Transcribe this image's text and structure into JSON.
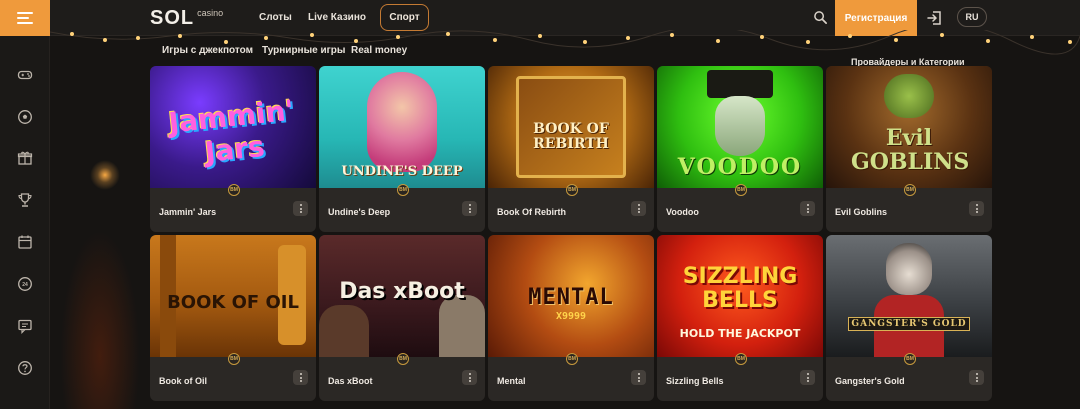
{
  "header": {
    "logo_main": "SOL",
    "logo_sub": "casino",
    "nav": {
      "slots": "Слоты",
      "live_casino": "Live Казино",
      "sport": "Спорт"
    },
    "register_label": "Регистрация",
    "lang_label": "RU",
    "accent_color": "#ef9a3c"
  },
  "sidebar": {
    "icons": [
      "gamepad-icon",
      "soccer-ball-icon",
      "gift-icon",
      "trophy-icon",
      "calendar-icon",
      "chat-24-icon",
      "message-icon",
      "help-icon"
    ]
  },
  "categories": {
    "jackpot": "Игры с джекпотом",
    "tournament": "Турнирные игры",
    "real_money": "Real money",
    "providers": "Провайдеры и Категории"
  },
  "badge_label": "BM",
  "games": [
    {
      "name": "Jammin' Jars",
      "art": "Jammin' Jars"
    },
    {
      "name": "Undine's Deep",
      "art": "UNDINE'S DEEP"
    },
    {
      "name": "Book Of Rebirth",
      "art": "BOOK OF REBIRTH"
    },
    {
      "name": "Voodoo",
      "art": "VOODOO"
    },
    {
      "name": "Evil Goblins",
      "art": "Evil GOBLINS"
    },
    {
      "name": "Book of Oil",
      "art": "BOOK OF OIL"
    },
    {
      "name": "Das xBoot",
      "art": "Das xBoot"
    },
    {
      "name": "Mental",
      "art": "MENTAL"
    },
    {
      "name": "Sizzling Bells",
      "art": "SIZZLING BELLS"
    },
    {
      "name": "Gangster's Gold",
      "art": "GANGSTER'S GOLD"
    }
  ],
  "games_art_sub": {
    "mental_sub": "X9999",
    "sizzling_sub": "HOLD THE JACKPOT"
  }
}
